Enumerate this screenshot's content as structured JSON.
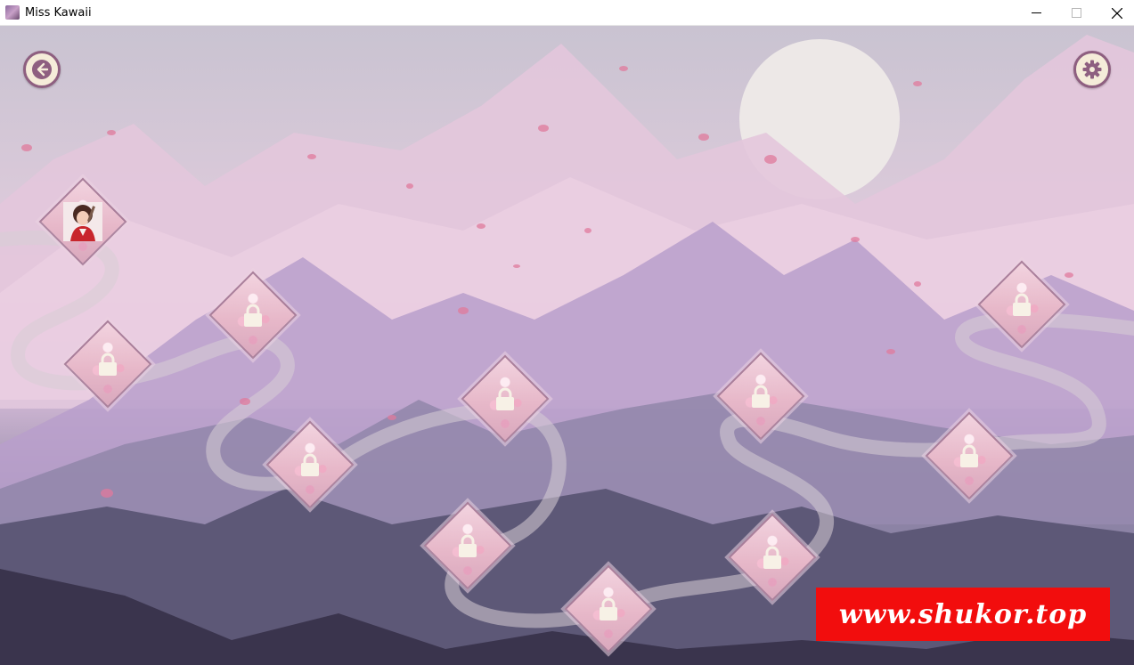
{
  "window": {
    "title": "Miss Kawaii",
    "controls": [
      "minimize-icon",
      "maximize-icon",
      "close-icon"
    ]
  },
  "game": {
    "back_icon": "arrow-left-icon",
    "settings_icon": "gear-icon",
    "colors": {
      "button_fill": "#f5ecd9",
      "button_ring": "#8e5f80",
      "sky": "#c9c3d1",
      "moon": "#eeeae8",
      "far_mountains": "#e3c6dc",
      "mid_mountains": "#b99fcb",
      "near_mountains": "#5d5877",
      "foreground": "#3a344d",
      "path": "#d7cdd6",
      "tile": "#e7b8c9"
    },
    "levels": [
      {
        "id": 1,
        "state": "unlocked",
        "icon": "character-portrait"
      },
      {
        "id": 2,
        "state": "locked",
        "icon": "lock-icon"
      },
      {
        "id": 3,
        "state": "locked",
        "icon": "lock-icon"
      },
      {
        "id": 4,
        "state": "locked",
        "icon": "lock-icon"
      },
      {
        "id": 5,
        "state": "locked",
        "icon": "lock-icon"
      },
      {
        "id": 6,
        "state": "locked",
        "icon": "lock-icon"
      },
      {
        "id": 7,
        "state": "locked",
        "icon": "lock-icon"
      },
      {
        "id": 8,
        "state": "locked",
        "icon": "lock-icon"
      },
      {
        "id": 9,
        "state": "locked",
        "icon": "lock-icon"
      },
      {
        "id": 10,
        "state": "locked",
        "icon": "lock-icon"
      },
      {
        "id": 11,
        "state": "locked",
        "icon": "lock-icon"
      },
      {
        "id": 12,
        "state": "locked",
        "icon": "lock-icon"
      }
    ]
  },
  "watermark": {
    "text": "www.shukor.top",
    "background": "#f20d0d"
  }
}
